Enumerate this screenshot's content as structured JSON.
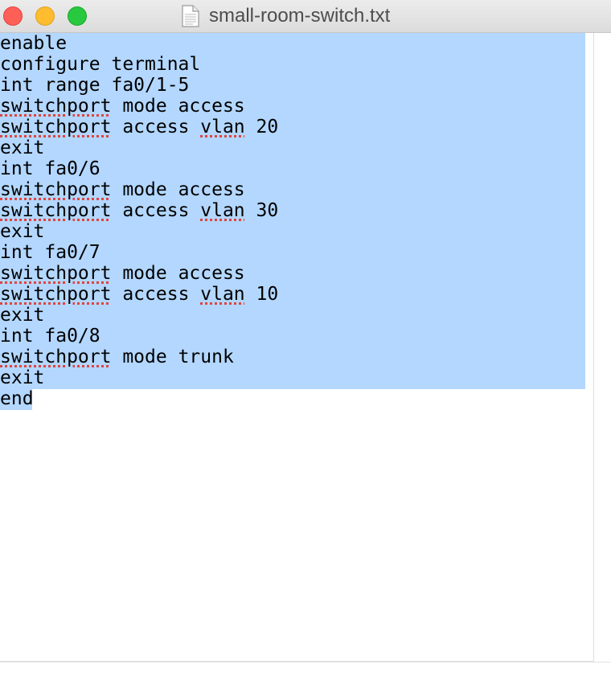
{
  "window": {
    "title": "small-room-switch.txt",
    "icon": "document-icon"
  },
  "editor": {
    "lines": [
      [
        {
          "t": "enable"
        }
      ],
      [
        {
          "t": "configure terminal"
        }
      ],
      [
        {
          "t": "int range fa0/1-5"
        }
      ],
      [
        {
          "t": "switchport",
          "spell": true
        },
        {
          "t": " mode access"
        }
      ],
      [
        {
          "t": "switchport",
          "spell": true
        },
        {
          "t": " access "
        },
        {
          "t": "vlan",
          "spell": true
        },
        {
          "t": " 20"
        }
      ],
      [
        {
          "t": "exit"
        }
      ],
      [
        {
          "t": "int fa0/6"
        }
      ],
      [
        {
          "t": "switchport",
          "spell": true
        },
        {
          "t": " mode access"
        }
      ],
      [
        {
          "t": "switchport",
          "spell": true
        },
        {
          "t": " access "
        },
        {
          "t": "vlan",
          "spell": true
        },
        {
          "t": " 30"
        }
      ],
      [
        {
          "t": "exit"
        }
      ],
      [
        {
          "t": "int fa0/7"
        }
      ],
      [
        {
          "t": "switchport",
          "spell": true
        },
        {
          "t": " mode access"
        }
      ],
      [
        {
          "t": "switchport",
          "spell": true
        },
        {
          "t": " access "
        },
        {
          "t": "vlan",
          "spell": true
        },
        {
          "t": " 10"
        }
      ],
      [
        {
          "t": "exit"
        }
      ],
      [
        {
          "t": "int fa0/8"
        }
      ],
      [
        {
          "t": "switchport",
          "spell": true
        },
        {
          "t": " mode trunk"
        }
      ],
      [
        {
          "t": "exit"
        }
      ],
      [
        {
          "t": "end"
        }
      ]
    ],
    "selection_color": "#b3d7ff",
    "spellcheck_color": "#e0443e"
  }
}
